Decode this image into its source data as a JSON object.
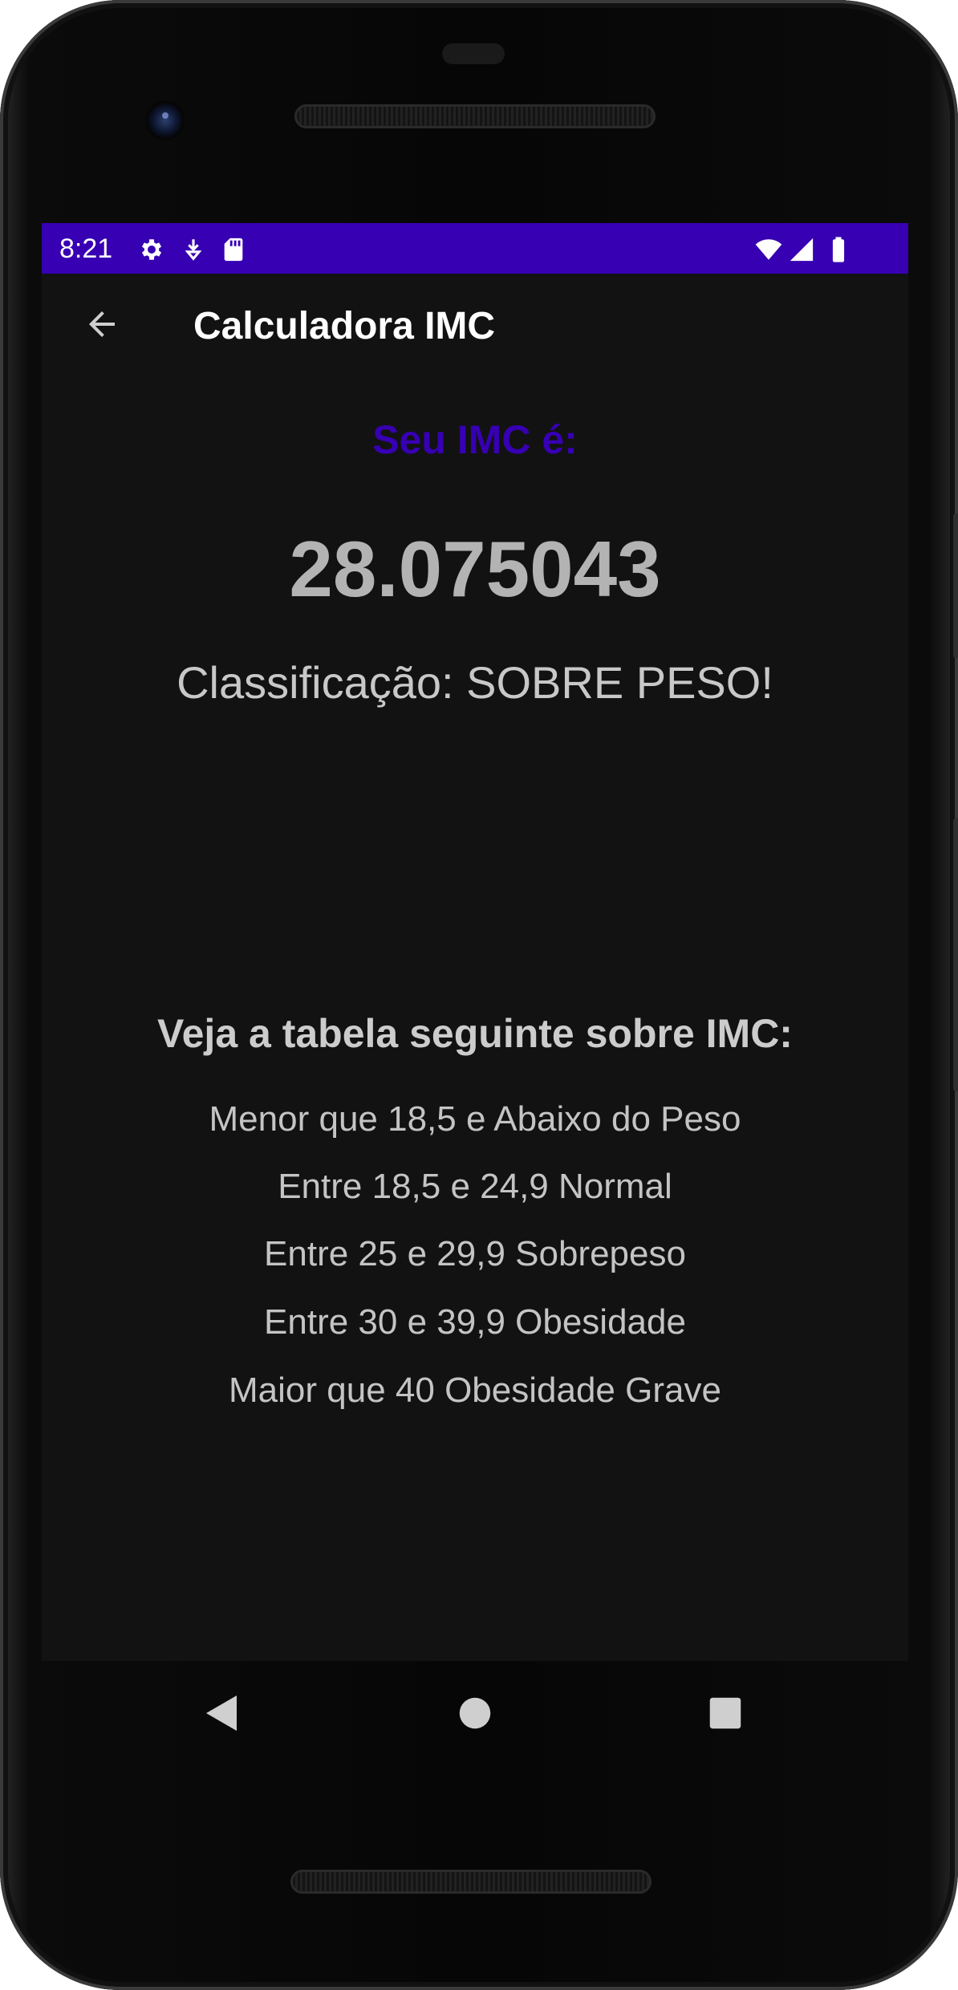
{
  "status_bar": {
    "time": "8:21",
    "icons": [
      "gear-icon",
      "download-icon",
      "sd-card-icon",
      "wifi-icon",
      "cell-signal-icon",
      "battery-icon"
    ],
    "background_color": "#3700b3"
  },
  "app_bar": {
    "title": "Calculadora IMC",
    "back_icon": "arrow-left-icon"
  },
  "result": {
    "label": "Seu IMC é:",
    "value": "28.075043",
    "classification": "Classificação: SOBRE PESO!",
    "label_color": "#3700b3"
  },
  "reference_table": {
    "title": "Veja a tabela seguinte sobre IMC:",
    "rows": [
      "Menor que 18,5 e  Abaixo do Peso",
      "Entre 18,5 e 24,9 Normal",
      "Entre 25 e 29,9 Sobrepeso",
      "Entre 30 e 39,9 Obesidade",
      "Maior que 40 Obesidade Grave"
    ]
  },
  "navigation_bar": {
    "buttons": [
      "back-triangle-icon",
      "home-circle-icon",
      "recents-square-icon"
    ]
  }
}
